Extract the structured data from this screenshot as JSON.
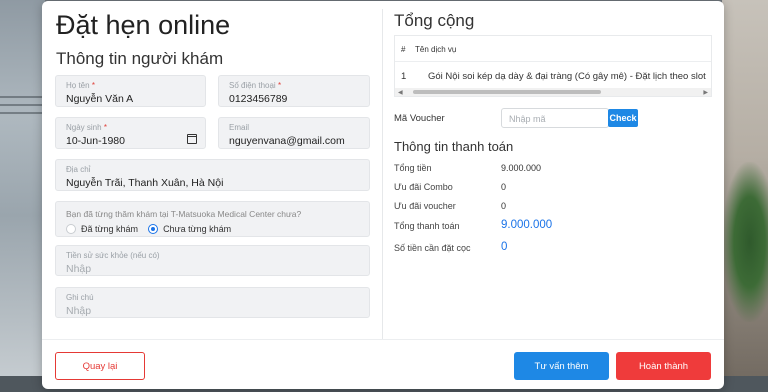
{
  "modal": {
    "title": "Đặt hẹn online",
    "subtitle": "Thông tin người khám"
  },
  "form": {
    "name": {
      "label": "Họ tên",
      "required": "*",
      "value": "Nguyễn Văn A"
    },
    "phone": {
      "label": "Số điện thoại",
      "required": "*",
      "value": "0123456789"
    },
    "dob": {
      "label": "Ngày sinh",
      "required": "*",
      "value": "10-Jun-1980"
    },
    "email": {
      "label": "Email",
      "value": "nguyenvana@gmail.com"
    },
    "address": {
      "label": "Địa chỉ",
      "value": "Nguyễn Trãi, Thanh Xuân, Hà Nội"
    },
    "visited": {
      "question": "Bạn đã từng thăm khám tại T-Matsuoka Medical Center chưa?",
      "options": [
        "Đã từng khám",
        "Chưa từng khám"
      ],
      "selected": "Chưa từng khám"
    },
    "history": {
      "label": "Tiền sử sức khỏe (nếu có)",
      "placeholder": "Nhập"
    },
    "notes": {
      "label": "Ghi chú",
      "placeholder": "Nhập"
    }
  },
  "summary": {
    "title": "Tổng cộng",
    "table": {
      "headers": [
        "#",
        "Tên dịch vụ"
      ],
      "rows": [
        [
          "1",
          "Gói Nội soi kép dạ dày & đại tràng (Có gây mê) - Đặt lịch theo slot"
        ]
      ]
    },
    "voucher": {
      "label": "Mã Voucher",
      "placeholder": "Nhập mã",
      "button": "Check"
    }
  },
  "payment": {
    "title": "Thông tin thanh toán",
    "rows": [
      {
        "label": "Tổng tiền",
        "value": "9.000.000"
      },
      {
        "label": "Ưu đãi Combo",
        "value": "0"
      },
      {
        "label": "Ưu đãi voucher",
        "value": "0"
      },
      {
        "label": "Tổng thanh toán",
        "value": "9.000.000"
      },
      {
        "label": "Số tiền cần đặt cọc",
        "value": "0"
      }
    ]
  },
  "buttons": {
    "back": "Quay lại",
    "consult": "Tư vấn thêm",
    "finish": "Hoàn thành"
  },
  "colors": {
    "primary": "#1e88e5",
    "danger": "#ef3b3b",
    "highlight": "#1a73e8"
  }
}
